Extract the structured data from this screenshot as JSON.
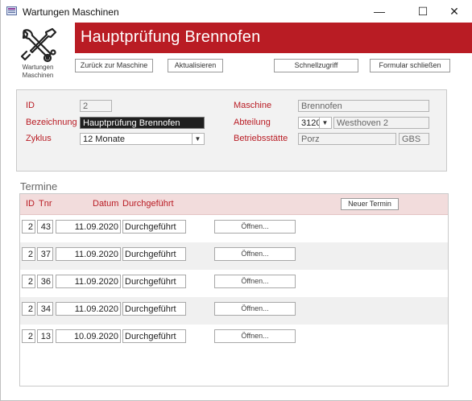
{
  "window": {
    "title": "Wartungen Maschinen",
    "minimize_glyph": "—",
    "maximize_glyph": "☐",
    "close_glyph": "✕"
  },
  "header": {
    "title": "Hauptprüfung Brennofen",
    "logo_icon": "wrench-screwdriver-icon",
    "logo_caption_line1": "Wartungen",
    "logo_caption_line2": "Maschinen",
    "accent_color": "#b91c24"
  },
  "toolbar": {
    "back_label": "Zurück zur Maschine",
    "refresh_label": "Aktualisieren",
    "quick_label": "Schnellzugriff",
    "close_label": "Formular schließen"
  },
  "detail": {
    "id_label": "ID",
    "id_value": "2",
    "bezeichnung_label": "Bezeichnung",
    "bezeichnung_value": "Hauptprüfung Brennofen",
    "zyklus_label": "Zyklus",
    "zyklus_value": "12 Monate",
    "maschine_label": "Maschine",
    "maschine_value": "Brennofen",
    "abteilung_label": "Abteilung",
    "abteilung_code": "3120",
    "abteilung_name": "Westhoven 2",
    "betriebsstaette_label": "Betriebsstätte",
    "betriebsstaette_value": "Porz",
    "betriebsstaette_code": "GBS"
  },
  "termine": {
    "section_label": "Termine",
    "headers": {
      "id": "ID",
      "tnr": "Tnr",
      "datum": "Datum",
      "durchgefuehrt": "Durchgeführt"
    },
    "new_button": "Neuer Termin",
    "rows": [
      {
        "id": "2",
        "tnr": "43",
        "datum": "11.09.2020",
        "status": "Durchgeführt",
        "open": "Öffnen..."
      },
      {
        "id": "2",
        "tnr": "37",
        "datum": "11.09.2020",
        "status": "Durchgeführt",
        "open": "Öffnen..."
      },
      {
        "id": "2",
        "tnr": "36",
        "datum": "11.09.2020",
        "status": "Durchgeführt",
        "open": "Öffnen..."
      },
      {
        "id": "2",
        "tnr": "34",
        "datum": "11.09.2020",
        "status": "Durchgeführt",
        "open": "Öffnen..."
      },
      {
        "id": "2",
        "tnr": "13",
        "datum": "10.09.2020",
        "status": "Durchgeführt",
        "open": "Öffnen..."
      }
    ]
  }
}
